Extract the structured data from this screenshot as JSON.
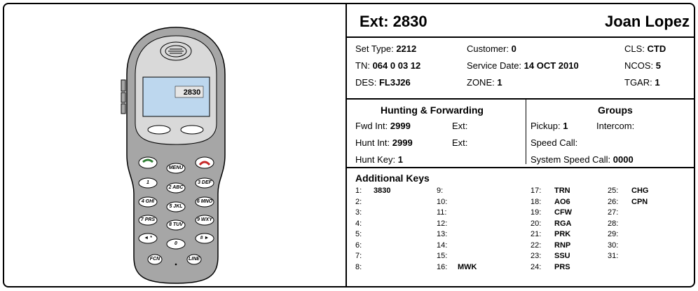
{
  "phone": {
    "screen_text": "2830",
    "keys": {
      "menu": "MENU",
      "k1": "1",
      "k2": "2 ABC",
      "k3": "3 DEF",
      "k4": "4 GHI",
      "k5": "5 JKL",
      "k6": "6 MNO",
      "k7": "7 PRS",
      "k8": "8 TUV",
      "k9": "9 WXY",
      "star": "◄ *",
      "zero": "0",
      "hash": "# ►",
      "fcn": "FCN",
      "line": "LINE"
    },
    "colors": {
      "body": "#a6a6a6",
      "face": "#d9d9d9",
      "screen": "#bdd7ee",
      "key": "#ffffff"
    }
  },
  "header": {
    "ext_label": "Ext: 2830",
    "name": "Joan Lopez"
  },
  "details": {
    "set_type_label": "Set Type:",
    "set_type": "2212",
    "customer_label": "Customer:",
    "customer": "0",
    "cls_label": "CLS:",
    "cls": "CTD",
    "tn_label": "TN:",
    "tn": "064 0 03 12",
    "service_date_label": "Service Date:",
    "service_date": "14 OCT 2010",
    "ncos_label": "NCOS:",
    "ncos": "5",
    "des_label": "DES:",
    "des": "FL3J26",
    "zone_label": "ZONE:",
    "zone": "1",
    "tgar_label": "TGAR:",
    "tgar": "1"
  },
  "hunting": {
    "title": "Hunting & Forwarding",
    "fwd_int_label": "Fwd  Int:",
    "fwd_int": "2999",
    "fwd_ext_label": "Ext:",
    "hunt_int_label": "Hunt Int:",
    "hunt_int": "2999",
    "hunt_ext_label": "Ext:",
    "hunt_key_label": "Hunt Key:",
    "hunt_key": "1"
  },
  "groups": {
    "title": "Groups",
    "pickup_label": "Pickup:",
    "pickup": "1",
    "intercom_label": "Intercom:",
    "speed_call_label": "Speed Call:",
    "system_speed_call_label": "System Speed Call:",
    "system_speed_call": "0000"
  },
  "additional_keys": {
    "title": "Additional Keys",
    "keys": [
      {
        "n": "1:",
        "v": "3830"
      },
      {
        "n": "2:",
        "v": ""
      },
      {
        "n": "3:",
        "v": ""
      },
      {
        "n": "4:",
        "v": ""
      },
      {
        "n": "5:",
        "v": ""
      },
      {
        "n": "6:",
        "v": ""
      },
      {
        "n": "7:",
        "v": ""
      },
      {
        "n": "8:",
        "v": ""
      },
      {
        "n": "9:",
        "v": ""
      },
      {
        "n": "10:",
        "v": ""
      },
      {
        "n": "11:",
        "v": ""
      },
      {
        "n": "12:",
        "v": ""
      },
      {
        "n": "13:",
        "v": ""
      },
      {
        "n": "14:",
        "v": ""
      },
      {
        "n": "15:",
        "v": ""
      },
      {
        "n": "16:",
        "v": "MWK"
      },
      {
        "n": "17:",
        "v": "TRN"
      },
      {
        "n": "18:",
        "v": "AO6"
      },
      {
        "n": "19:",
        "v": "CFW"
      },
      {
        "n": "20:",
        "v": "RGA"
      },
      {
        "n": "21:",
        "v": "PRK"
      },
      {
        "n": "22:",
        "v": "RNP"
      },
      {
        "n": "23:",
        "v": "SSU"
      },
      {
        "n": "24:",
        "v": "PRS"
      },
      {
        "n": "25:",
        "v": "CHG"
      },
      {
        "n": "26:",
        "v": "CPN"
      },
      {
        "n": "27:",
        "v": ""
      },
      {
        "n": "28:",
        "v": ""
      },
      {
        "n": "29:",
        "v": ""
      },
      {
        "n": "30:",
        "v": ""
      },
      {
        "n": "31:",
        "v": ""
      }
    ]
  }
}
